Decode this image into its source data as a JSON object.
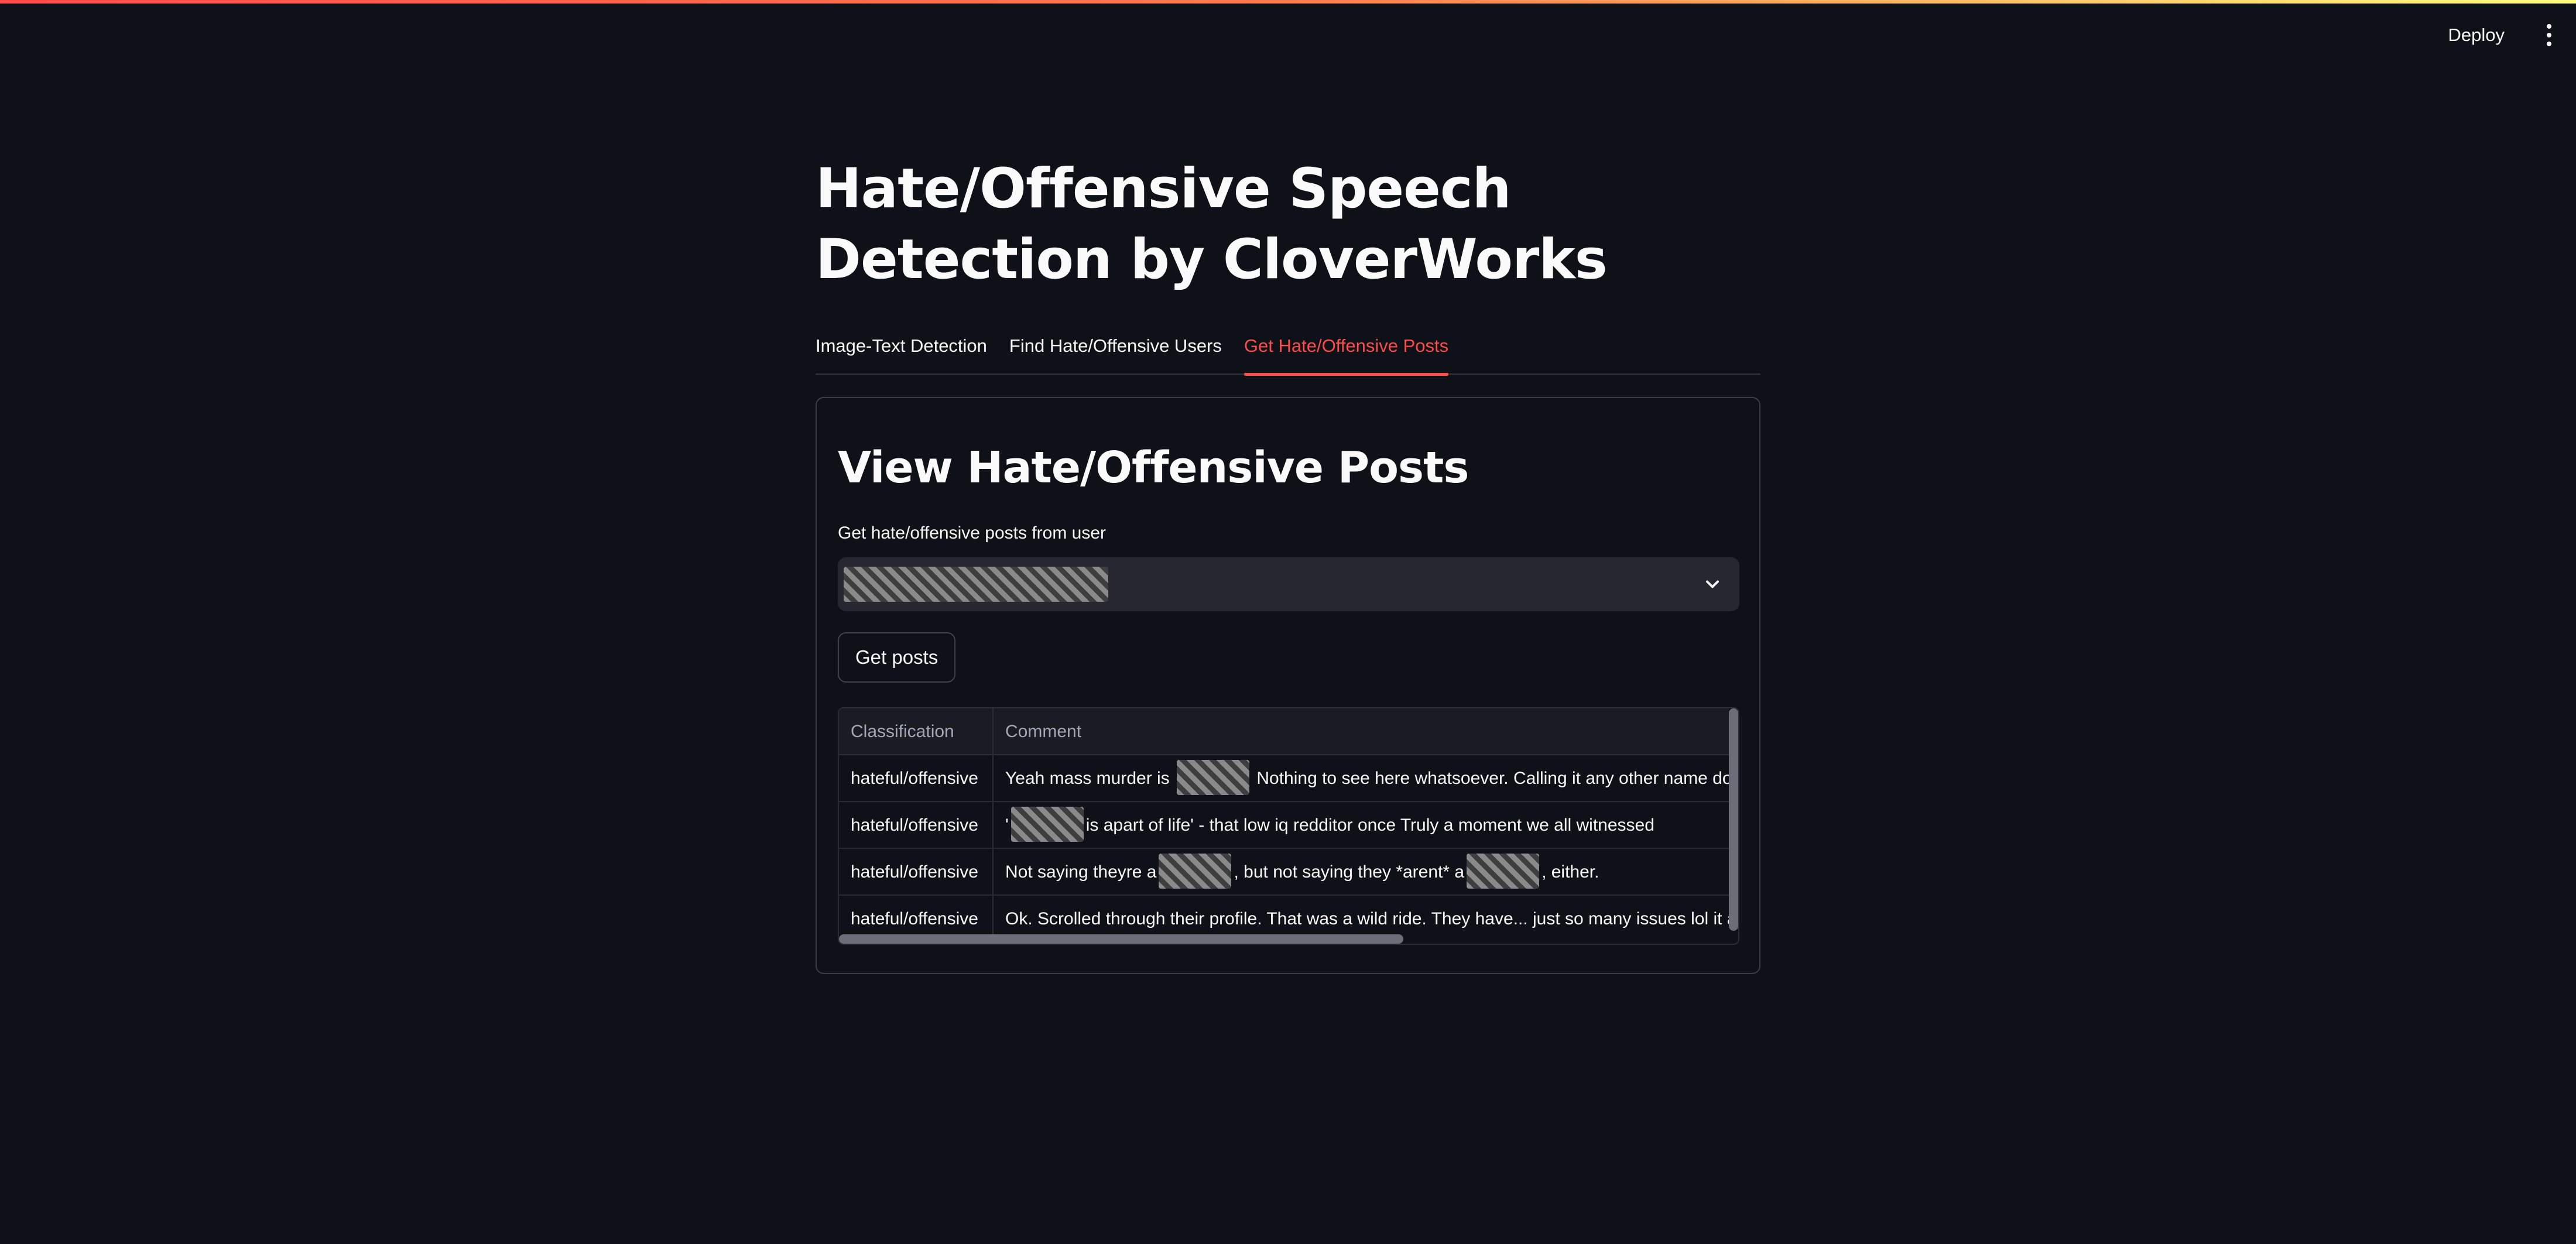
{
  "header": {
    "deploy_label": "Deploy",
    "menu_icon": "vertical-ellipsis-icon"
  },
  "page": {
    "title": "Hate/Offensive Speech Detection by CloverWorks"
  },
  "tabs": [
    {
      "label": "Image-Text Detection",
      "active": false
    },
    {
      "label": "Find Hate/Offensive Users",
      "active": false
    },
    {
      "label": "Get Hate/Offensive Posts",
      "active": true
    }
  ],
  "section": {
    "title": "View Hate/Offensive Posts",
    "select_label": "Get hate/offensive posts from user",
    "select_value": "[redacted]",
    "button_label": "Get posts"
  },
  "table": {
    "columns": [
      "Classification",
      "Comment"
    ],
    "rows": [
      {
        "classification": "hateful/offensive",
        "before": "Yeah mass murder is ",
        "after": " Nothing to see here whatsoever.  Calling it any other name doe"
      },
      {
        "classification": "hateful/offensive",
        "before": "'",
        "after": "is apart of life'  - that low iq redditor once  Truly a moment we all witnessed"
      },
      {
        "classification": "hateful/offensive",
        "before": "Not saying theyre a",
        "middle": ", but not saying they *arent* a",
        "after": ", either."
      },
      {
        "classification": "hateful/offensive",
        "before": "Ok. Scrolled through their profile. That was a wild ride. They have... just so many issues lol it a",
        "after": ""
      }
    ]
  },
  "colors": {
    "background": "#0e1117",
    "accent": "#ff4b4b",
    "text": "#fafafa",
    "input_bg": "#262730"
  }
}
